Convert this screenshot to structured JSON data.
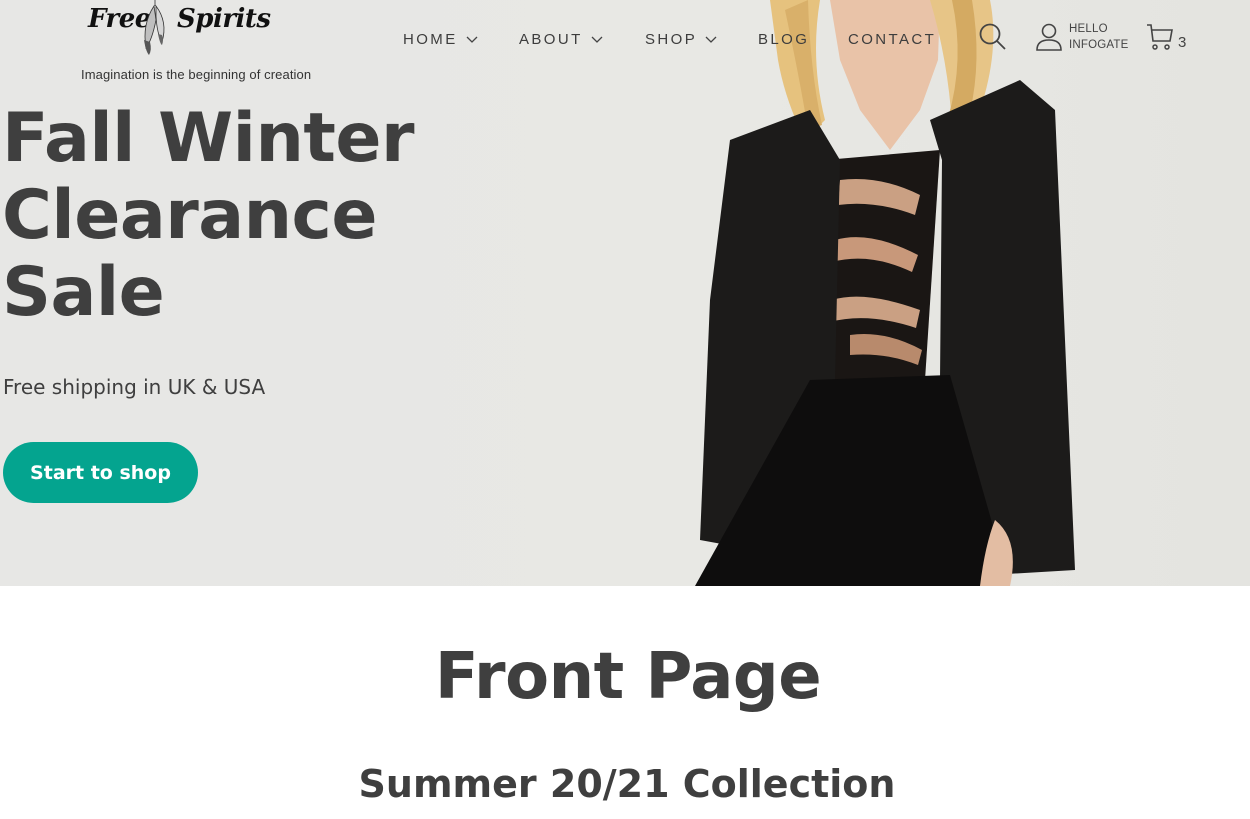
{
  "brand": {
    "logo_word_1": "Free",
    "logo_word_2": "Spirits",
    "tagline": "Imagination is the beginning of creation"
  },
  "nav": {
    "items": [
      {
        "label": "HOME",
        "has_dropdown": true
      },
      {
        "label": "ABOUT",
        "has_dropdown": true
      },
      {
        "label": "SHOP",
        "has_dropdown": true
      },
      {
        "label": "BLOG",
        "has_dropdown": false
      },
      {
        "label": "CONTACT",
        "has_dropdown": false
      }
    ]
  },
  "header_actions": {
    "search_icon": "search-icon",
    "account_icon": "user-icon",
    "account_greeting": "HELLO",
    "account_name": "INFOGATE",
    "cart_icon": "cart-icon",
    "cart_count": "3"
  },
  "hero": {
    "title_lines": [
      "Fall Winter",
      "Clearance",
      "Sale"
    ],
    "subtitle": "Free shipping in UK & USA",
    "cta_label": "Start to shop",
    "cta_color": "#04a48f",
    "background_color": "#e7e7e5"
  },
  "main": {
    "page_title": "Front Page",
    "section_title": "Summer 20/21 Collection"
  }
}
